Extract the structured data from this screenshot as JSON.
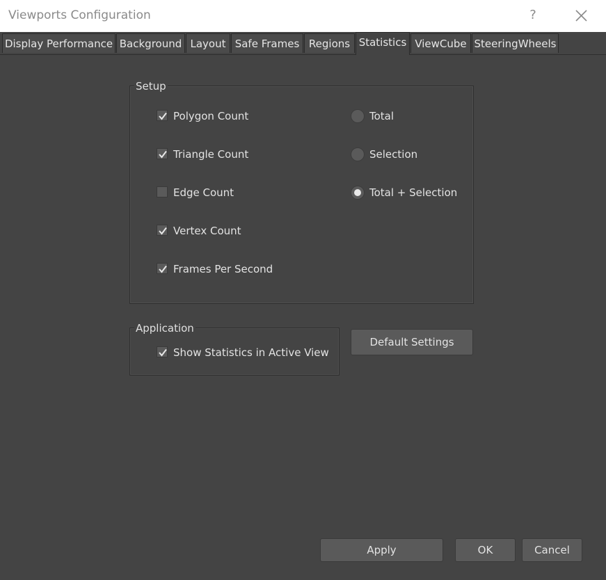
{
  "window": {
    "title": "Viewports Configuration",
    "help_label": "?",
    "close_icon": "close-icon"
  },
  "tabs": [
    {
      "label": "Display Performance",
      "active": false
    },
    {
      "label": "Background",
      "active": false
    },
    {
      "label": "Layout",
      "active": false
    },
    {
      "label": "Safe Frames",
      "active": false
    },
    {
      "label": "Regions",
      "active": false
    },
    {
      "label": "Statistics",
      "active": true
    },
    {
      "label": "ViewCube",
      "active": false
    },
    {
      "label": "SteeringWheels",
      "active": false
    }
  ],
  "setup": {
    "label": "Setup",
    "checkboxes": [
      {
        "label": "Polygon Count",
        "checked": true
      },
      {
        "label": "Triangle Count",
        "checked": true
      },
      {
        "label": "Edge Count",
        "checked": false
      },
      {
        "label": "Vertex Count",
        "checked": true
      },
      {
        "label": "Frames Per Second",
        "checked": true
      }
    ],
    "radios": [
      {
        "label": "Total",
        "selected": false
      },
      {
        "label": "Selection",
        "selected": false
      },
      {
        "label": "Total + Selection",
        "selected": true
      }
    ]
  },
  "application": {
    "label": "Application",
    "show_stats": {
      "label": "Show Statistics in Active View",
      "checked": true
    }
  },
  "buttons": {
    "default_settings": "Default Settings",
    "apply": "Apply",
    "ok": "OK",
    "cancel": "Cancel"
  },
  "colors": {
    "background": "#444444",
    "titlebar": "#ffffff",
    "button": "#5a5a5a",
    "text": "#e3e3e3"
  }
}
